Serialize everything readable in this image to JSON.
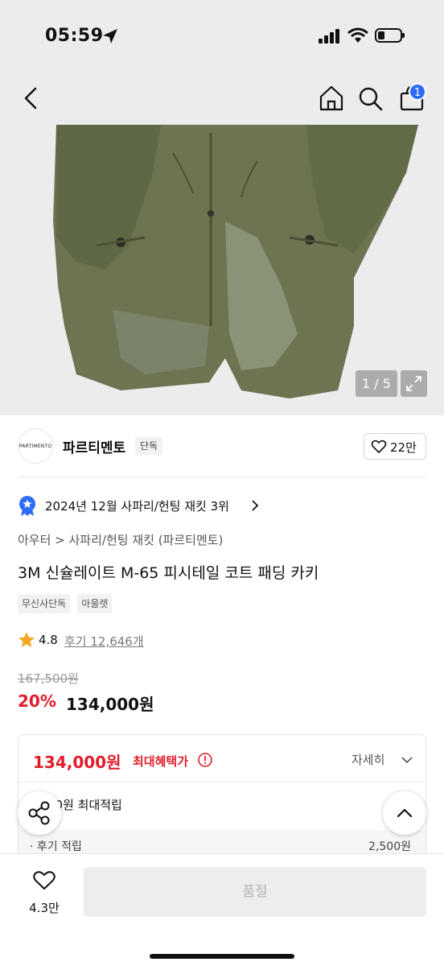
{
  "status_bar": {
    "time": "05:59"
  },
  "nav": {
    "cart_count": "1"
  },
  "gallery": {
    "counter": "1 / 5"
  },
  "brand": {
    "logo_text": "PARTIMENTO",
    "name": "파르티멘토",
    "tag": "단독",
    "likes": "22만"
  },
  "ranking": {
    "text": "2024년 12월 사파리/헌팅 재킷 3위"
  },
  "product": {
    "breadcrumb": "아우터 > 사파리/헌팅 재킷 (파르티멘토)",
    "title": "3M 신슐레이트 M-65 피시테일 코트 패딩 카키",
    "tags": [
      "무신사단독",
      "아울렛"
    ],
    "rating": "4.8",
    "reviews": "후기 12,646개",
    "price_original": "167,500원",
    "discount": "20%",
    "price": "134,000원"
  },
  "benefit": {
    "price": "134,000원",
    "label": "최대혜택가",
    "detail": "자세히",
    "points": "00원 최대적립",
    "review_points_label": "· 후기 적립",
    "review_points_value": "2,500원"
  },
  "bottom": {
    "wish_count": "4.3만",
    "buy_label": "품절"
  },
  "colors": {
    "accent_red": "#e11d2b",
    "badge_blue": "#2f6cf6"
  }
}
